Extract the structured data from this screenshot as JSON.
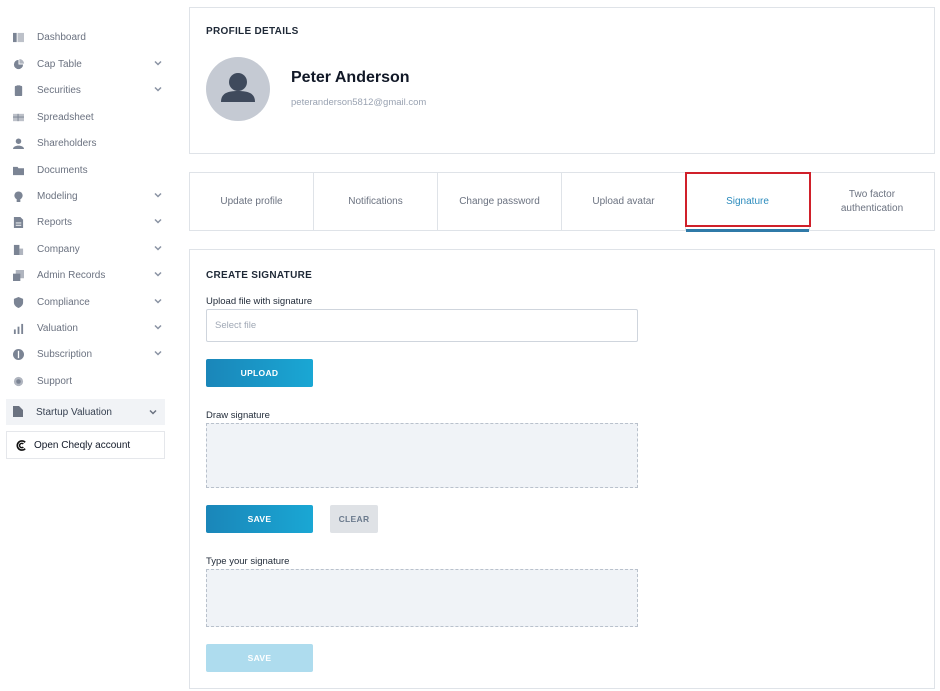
{
  "sidebar": {
    "items": [
      {
        "label": "Dashboard",
        "icon": "dashboard-icon",
        "chevron": false
      },
      {
        "label": "Cap Table",
        "icon": "pie-chart-icon",
        "chevron": true
      },
      {
        "label": "Securities",
        "icon": "clipboard-icon",
        "chevron": true
      },
      {
        "label": "Spreadsheet",
        "icon": "table-icon",
        "chevron": false
      },
      {
        "label": "Shareholders",
        "icon": "user-icon",
        "chevron": false
      },
      {
        "label": "Documents",
        "icon": "folder-icon",
        "chevron": false
      },
      {
        "label": "Modeling",
        "icon": "lightbulb-icon",
        "chevron": true
      },
      {
        "label": "Reports",
        "icon": "report-icon",
        "chevron": true
      },
      {
        "label": "Company",
        "icon": "building-icon",
        "chevron": true
      },
      {
        "label": "Admin Records",
        "icon": "records-icon",
        "chevron": true
      },
      {
        "label": "Compliance",
        "icon": "shield-icon",
        "chevron": true
      },
      {
        "label": "Valuation",
        "icon": "bar-chart-icon",
        "chevron": true
      },
      {
        "label": "Subscription",
        "icon": "dollar-icon",
        "chevron": true
      },
      {
        "label": "Support",
        "icon": "support-icon",
        "chevron": false
      }
    ],
    "startup_valuation": "Startup Valuation",
    "cheqly": "Open Cheqly account"
  },
  "profile": {
    "section_title": "PROFILE DETAILS",
    "name": "Peter Anderson",
    "email": "peteranderson5812@gmail.com"
  },
  "tabs": [
    {
      "label": "Update profile",
      "active": false
    },
    {
      "label": "Notifications",
      "active": false
    },
    {
      "label": "Change password",
      "active": false
    },
    {
      "label": "Upload avatar",
      "active": false
    },
    {
      "label": "Signature",
      "active": true
    },
    {
      "label": "Two factor authentication",
      "active": false
    }
  ],
  "signature": {
    "section_title": "CREATE SIGNATURE",
    "upload_label": "Upload file with signature",
    "file_placeholder": "Select file",
    "upload_button": "UPLOAD",
    "draw_label": "Draw signature",
    "save_button": "SAVE",
    "clear_button": "CLEAR",
    "type_label": "Type your signature",
    "type_save_button": "SAVE"
  },
  "colors": {
    "accent": "#1a9bcb",
    "highlight_border": "#d0202a",
    "disabled_button": "#aedcee"
  }
}
